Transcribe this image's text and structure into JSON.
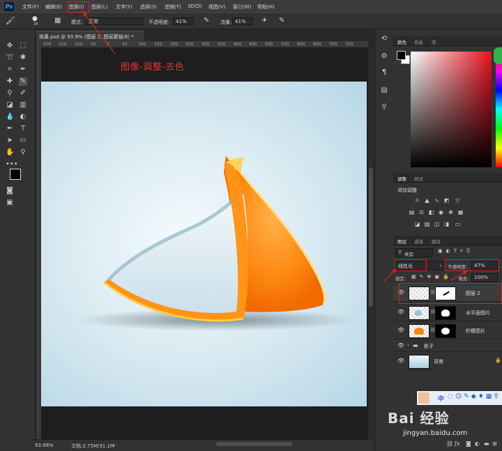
{
  "app": {
    "logo": "Ps"
  },
  "menu": {
    "items": [
      "文件(F)",
      "编辑(E)",
      "图像(I)",
      "图层(L)",
      "文字(Y)",
      "选择(S)",
      "滤镜(T)",
      "3D(D)",
      "视图(V)",
      "窗口(W)",
      "帮助(H)"
    ],
    "highlighted": "图像(I)"
  },
  "options": {
    "mode_label": "模式:",
    "mode_value": "正常",
    "opacity_label": "不透明度:",
    "opacity_value": "41%",
    "flow_label": "流量:",
    "flow_value": "41%",
    "brush_size": "34"
  },
  "document": {
    "tab_title": "效果.psd @ 93.9% (图层 2, 图层蒙版/8) *",
    "ruler_marks": [
      "200",
      "150",
      "100",
      "50",
      "0",
      "50",
      "100",
      "150",
      "200",
      "250",
      "300",
      "350",
      "400",
      "450",
      "500",
      "550",
      "600",
      "650",
      "700",
      "750"
    ],
    "zoom": "93.88%",
    "doc_size": "文档:2.75M/31.1M"
  },
  "annotation": {
    "text": "图像-调整-去色",
    "color": "#e83232"
  },
  "color_panel": {
    "tabs": [
      "颜色",
      "色板",
      "库"
    ],
    "fg": "#000000",
    "bg": "#ffffff",
    "accent": "#e8131f"
  },
  "adjust_panel": {
    "tabs": [
      "调整",
      "样式"
    ],
    "title": "添加调整"
  },
  "layers_panel": {
    "tabs": [
      "图层",
      "通道",
      "路径"
    ],
    "filter_label": "类型",
    "blend_mode": "线性光",
    "opacity_label": "不透明度:",
    "opacity_value": "47%",
    "lock_label": "锁定:",
    "fill_label": "填充:",
    "fill_value": "100%",
    "layers": [
      {
        "name": "图层 2",
        "selected": true
      },
      {
        "name": "水平面图片",
        "selected": false
      },
      {
        "name": "柠檬图片",
        "selected": false
      },
      {
        "name": "影子",
        "group": true
      },
      {
        "name": "背景",
        "locked": true
      }
    ]
  },
  "watermark": {
    "brand": "Bai 经验",
    "url": "jingyan.baidu.com",
    "toolbar_label": "中"
  }
}
